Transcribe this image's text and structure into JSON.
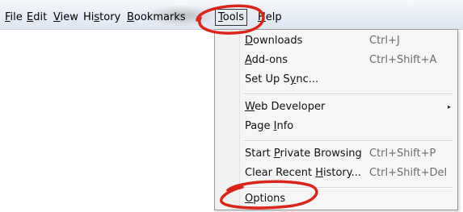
{
  "menubar": {
    "items": [
      {
        "pre": "",
        "u": "F",
        "post": "ile"
      },
      {
        "pre": "",
        "u": "E",
        "post": "dit"
      },
      {
        "pre": "",
        "u": "V",
        "post": "iew"
      },
      {
        "pre": "Hi",
        "u": "s",
        "post": "tory"
      },
      {
        "pre": "",
        "u": "B",
        "post": "ookmarks"
      },
      {
        "pre": "",
        "u": "T",
        "post": "ools"
      },
      {
        "pre": "",
        "u": "H",
        "post": "elp"
      }
    ]
  },
  "tools_menu": {
    "items": [
      {
        "pre": "",
        "u": "D",
        "post": "ownloads",
        "shortcut": "Ctrl+J"
      },
      {
        "pre": "",
        "u": "A",
        "post": "dd-ons",
        "shortcut": "Ctrl+Shift+A"
      },
      {
        "pre": "Set Up S",
        "u": "y",
        "post": "nc...",
        "shortcut": ""
      },
      {
        "pre": "",
        "u": "W",
        "post": "eb Developer",
        "shortcut": "",
        "submenu": "▸"
      },
      {
        "pre": "Page ",
        "u": "I",
        "post": "nfo",
        "shortcut": ""
      },
      {
        "pre": "Start ",
        "u": "P",
        "post": "rivate Browsing",
        "shortcut": "Ctrl+Shift+P"
      },
      {
        "pre": "Clear Recent ",
        "u": "H",
        "post": "istory...",
        "shortcut": "Ctrl+Shift+Del"
      },
      {
        "pre": "",
        "u": "O",
        "post": "ptions",
        "shortcut": ""
      }
    ]
  },
  "colors": {
    "annotation_red": "#d8261c"
  }
}
